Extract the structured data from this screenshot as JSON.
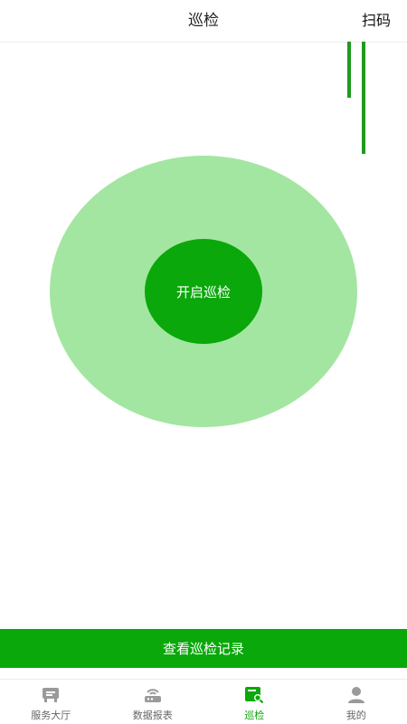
{
  "header": {
    "title": "巡检",
    "action_label": "扫码"
  },
  "patrol": {
    "start_label": "开启巡检"
  },
  "records_button": {
    "label": "查看巡检记录"
  },
  "tabbar": {
    "items": [
      {
        "label": "服务大厅",
        "icon": "service-hall-icon",
        "active": false
      },
      {
        "label": "数据报表",
        "icon": "data-report-icon",
        "active": false
      },
      {
        "label": "巡检",
        "icon": "patrol-icon",
        "active": true
      },
      {
        "label": "我的",
        "icon": "profile-icon",
        "active": false
      }
    ]
  },
  "colors": {
    "primary_green": "#0aa80a",
    "light_green": "#a3e6a1",
    "inactive_gray": "#9a9a9a"
  }
}
